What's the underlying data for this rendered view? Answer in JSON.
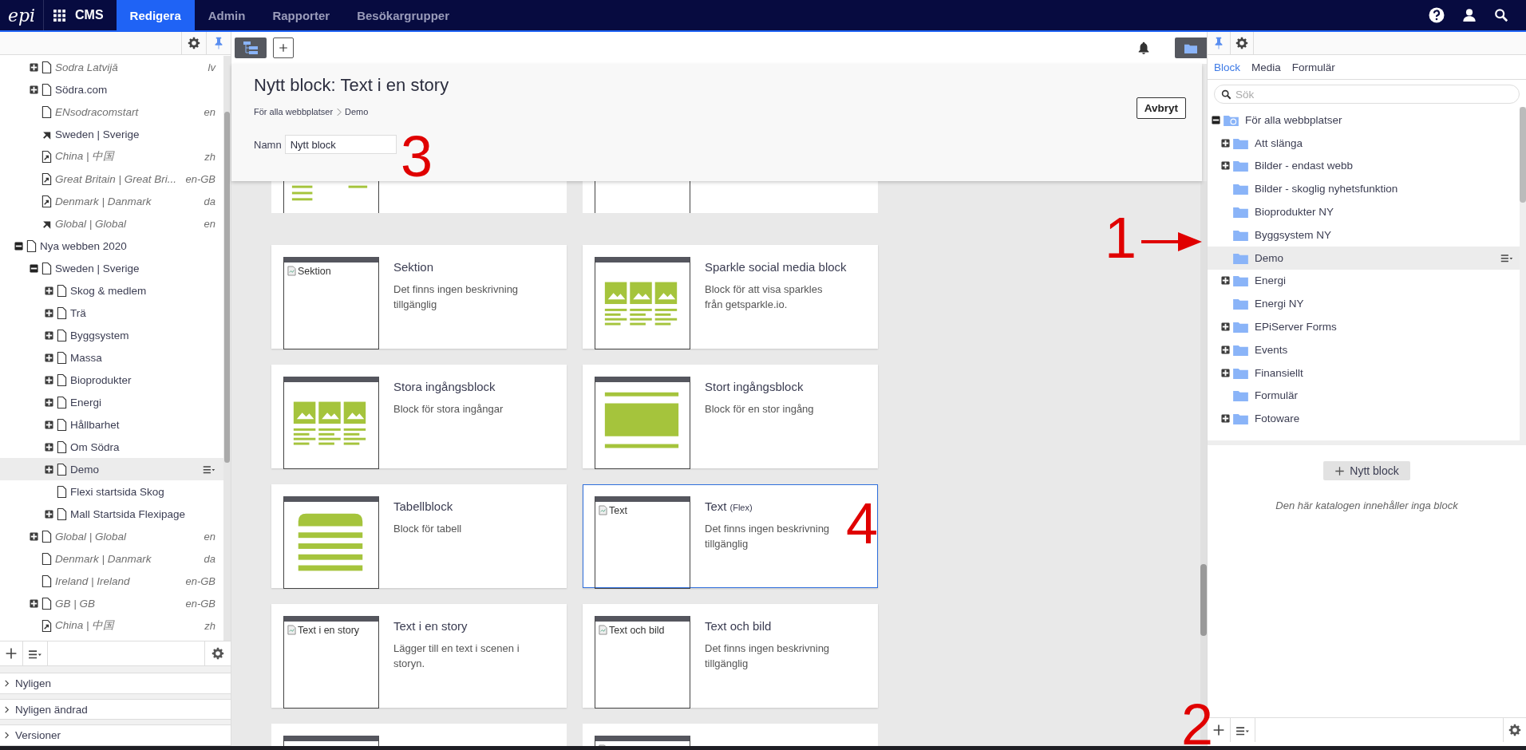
{
  "topbar": {
    "logo": "epi",
    "app": "CMS",
    "tabs": [
      {
        "label": "Redigera",
        "selected": true
      },
      {
        "label": "Admin",
        "selected": false
      },
      {
        "label": "Rapporter",
        "selected": false
      },
      {
        "label": "Besökargrupper",
        "selected": false
      }
    ]
  },
  "page_tree": {
    "continued_children": [
      {
        "label": "Sodra Latvijā",
        "lang": "lv",
        "italic": true,
        "kind": "page",
        "expanded": false,
        "selected": false
      },
      {
        "label": "Södra.com",
        "italic": false,
        "kind": "page",
        "expanded": false,
        "selected": false
      },
      {
        "label": "ENsodracomstart",
        "lang": "en",
        "italic": true,
        "kind": "page",
        "selected": false
      },
      {
        "label": "Sweden | Sverige",
        "italic": false,
        "kind": "shortcut",
        "selected": false
      },
      {
        "label": "China | 中国",
        "lang": "zh",
        "italic": true,
        "kind": "link",
        "selected": false
      },
      {
        "label": "Great Britain | Great Bri...",
        "lang": "en-GB",
        "italic": true,
        "kind": "link",
        "selected": false
      },
      {
        "label": "Denmark | Danmark",
        "lang": "da",
        "italic": true,
        "kind": "link",
        "selected": false
      },
      {
        "label": "Global | Global",
        "lang": "en",
        "italic": true,
        "kind": "shortcut",
        "selected": false
      }
    ],
    "items": [
      {
        "label": "Nya webben 2020",
        "italic": false,
        "kind": "page",
        "expanded": true,
        "selected": false,
        "children": [
          {
            "label": "Sweden | Sverige",
            "italic": false,
            "kind": "page",
            "expanded": true,
            "selected": false,
            "children": [
              {
                "label": "Skog & medlem",
                "italic": false,
                "kind": "page",
                "expanded": false,
                "selected": false
              },
              {
                "label": "Trä",
                "italic": false,
                "kind": "page",
                "expanded": false,
                "selected": false
              },
              {
                "label": "Byggsystem",
                "italic": false,
                "kind": "page",
                "expanded": false,
                "selected": false
              },
              {
                "label": "Massa",
                "italic": false,
                "kind": "page",
                "expanded": false,
                "selected": false
              },
              {
                "label": "Bioprodukter",
                "italic": false,
                "kind": "page",
                "expanded": false,
                "selected": false
              },
              {
                "label": "Energi",
                "italic": false,
                "kind": "page",
                "expanded": false,
                "selected": false
              },
              {
                "label": "Hållbarhet",
                "italic": false,
                "kind": "page",
                "expanded": false,
                "selected": false
              },
              {
                "label": "Om Södra",
                "italic": false,
                "kind": "page",
                "expanded": false,
                "selected": false
              },
              {
                "label": "Demo",
                "italic": false,
                "kind": "page",
                "expanded": false,
                "selected": true
              },
              {
                "label": "Flexi startsida Skog",
                "italic": false,
                "kind": "page",
                "selected": false
              },
              {
                "label": "Mall Startsida Flexipage",
                "italic": false,
                "kind": "page",
                "expanded": false,
                "selected": false
              }
            ]
          },
          {
            "label": "Global | Global",
            "lang": "en",
            "italic": true,
            "kind": "page",
            "expanded": false,
            "selected": false
          },
          {
            "label": "Denmark | Danmark",
            "lang": "da",
            "italic": true,
            "kind": "page",
            "selected": false
          },
          {
            "label": "Ireland | Ireland",
            "lang": "en-GB",
            "italic": true,
            "kind": "page",
            "selected": false
          },
          {
            "label": "GB | GB",
            "lang": "en-GB",
            "italic": true,
            "kind": "page",
            "expanded": false,
            "selected": false
          },
          {
            "label": "China | 中国",
            "lang": "zh",
            "italic": true,
            "kind": "link",
            "selected": false
          }
        ]
      }
    ]
  },
  "recent_panels": [
    {
      "label": "Nyligen",
      "expanded": false
    },
    {
      "label": "Nyligen ändrad",
      "expanded": false
    },
    {
      "label": "Versioner",
      "expanded": false
    }
  ],
  "editor": {
    "title": "Nytt block: Text i en story",
    "breadcrumb": [
      "För alla webbplatser",
      "Demo"
    ],
    "name_label": "Namn",
    "name_value": "Nytt block",
    "cancel": "Avbryt"
  },
  "cards_above": [
    {
      "kind": "lines"
    },
    {
      "kind": "blank"
    }
  ],
  "block_types": [
    {
      "kind": "broken-image",
      "alt": "Sektion",
      "title": "Sektion",
      "description": "Det finns ingen beskrivning tillgänglig",
      "selected": false
    },
    {
      "kind": "gallery",
      "title": "Sparkle social media block",
      "description": "Block för att visa sparkles från getsparkle.io.",
      "selected": false
    },
    {
      "kind": "gallery",
      "title": "Stora ingångsblock",
      "description": "Block för stora ingångar",
      "selected": false
    },
    {
      "kind": "banner",
      "title": "Stort ingångsblock",
      "description": "Block för en stor ingång",
      "selected": false
    },
    {
      "kind": "table",
      "title": "Tabellblock",
      "description": "Block för tabell",
      "selected": false
    },
    {
      "kind": "broken-image",
      "alt": "Text",
      "title": "Text",
      "tag": "(Flex)",
      "description": "Det finns ingen beskrivning tillgänglig",
      "selected": true
    },
    {
      "kind": "broken-image",
      "alt": "Text i en story",
      "title": "Text i en story",
      "description": "Lägger till en text i scenen i storyn.",
      "selected": false
    },
    {
      "kind": "broken-image",
      "alt": "Text och bild",
      "title": "Text och bild",
      "description": "Det finns ingen beskrivning tillgänglig",
      "selected": false
    }
  ],
  "cards_below": [
    {
      "kind": "blank"
    },
    {
      "kind": "broken-image"
    }
  ],
  "assets": {
    "tabs": [
      {
        "label": "Block",
        "selected": true
      },
      {
        "label": "Media",
        "selected": false
      },
      {
        "label": "Formulär",
        "selected": false
      }
    ],
    "search": {
      "placeholder": "Sök"
    },
    "tree": {
      "label": "För alla webbplatser",
      "kind": "shared",
      "expanded": true,
      "selected": false,
      "children": [
        {
          "label": "Att slänga",
          "kind": "folder",
          "expanded": false,
          "selected": false
        },
        {
          "label": "Bilder - endast webb",
          "kind": "folder",
          "expanded": false,
          "selected": false
        },
        {
          "label": "Bilder - skoglig nyhetsfunktion",
          "kind": "folder",
          "selected": false
        },
        {
          "label": "Bioprodukter NY",
          "kind": "folder",
          "selected": false
        },
        {
          "label": "Byggsystem NY",
          "kind": "folder",
          "selected": false
        },
        {
          "label": "Demo",
          "kind": "folder",
          "selected": true
        },
        {
          "label": "Energi",
          "kind": "folder",
          "expanded": false,
          "selected": false
        },
        {
          "label": "Energi NY",
          "kind": "folder",
          "selected": false
        },
        {
          "label": "EPiServer Forms",
          "kind": "folder",
          "expanded": false,
          "selected": false
        },
        {
          "label": "Events",
          "kind": "folder",
          "expanded": false,
          "selected": false
        },
        {
          "label": "Finansiellt",
          "kind": "folder",
          "expanded": false,
          "selected": false
        },
        {
          "label": "Formulär",
          "kind": "folder",
          "selected": false
        },
        {
          "label": "Fotoware",
          "kind": "folder",
          "expanded": false,
          "selected": false
        }
      ]
    },
    "new_button": "Nytt block",
    "empty_message": "Den här katalogen innehåller inga block"
  },
  "annotations": [
    {
      "label": "1",
      "kind": "arrow"
    },
    {
      "label": "2",
      "kind": "number"
    },
    {
      "label": "3",
      "kind": "number"
    },
    {
      "label": "4",
      "kind": "number"
    }
  ]
}
